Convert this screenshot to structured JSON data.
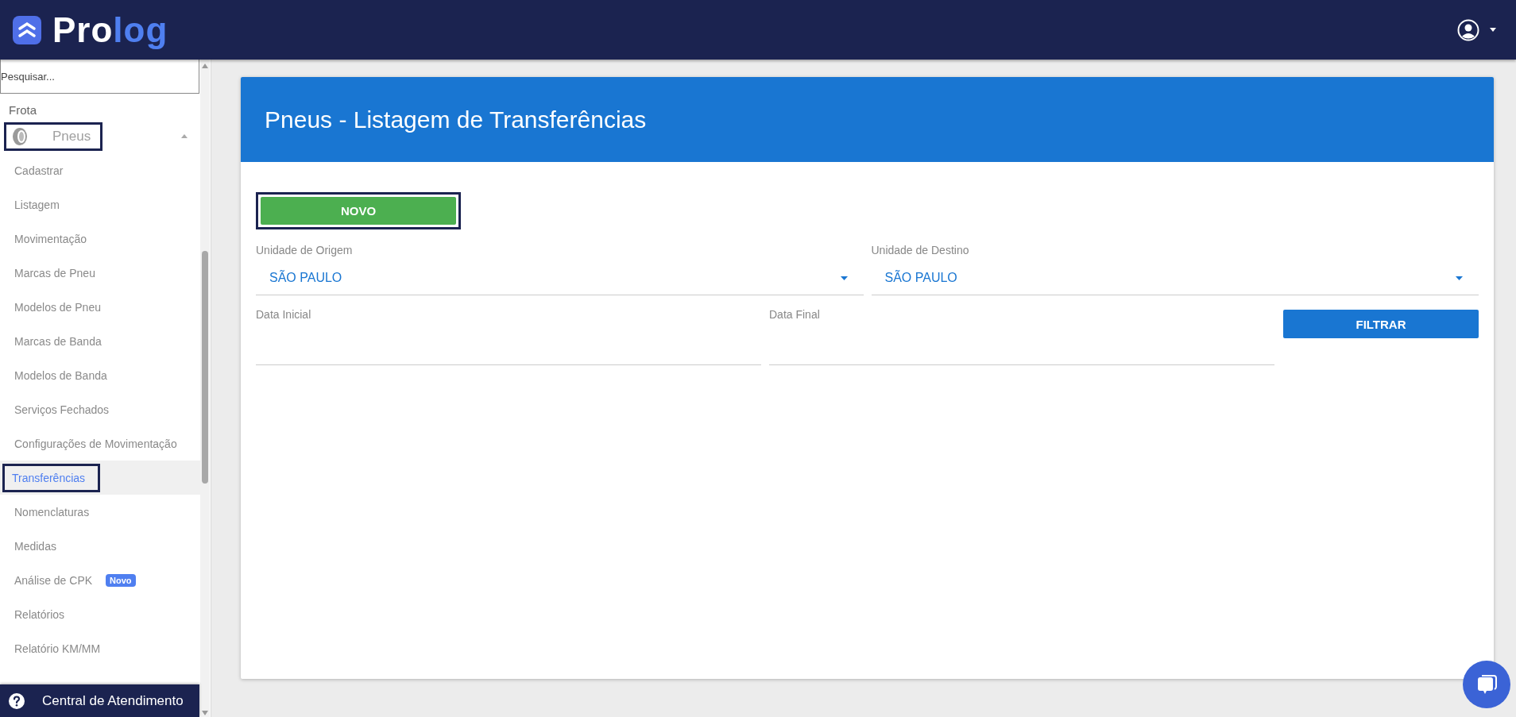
{
  "header": {
    "logo": [
      {
        "text": "Pro",
        "color": "#ffffff"
      },
      {
        "text": "log",
        "color": "#4f7ff0"
      }
    ]
  },
  "sidebar": {
    "search": {
      "placeholder": "Pesquisar..."
    },
    "section": "Frota",
    "groups": [
      {
        "label": "Pneus",
        "expanded": true,
        "outlined": true,
        "children": [
          {
            "label": "Cadastrar",
            "selected": false,
            "outlined": false
          },
          {
            "label": "Listagem",
            "selected": false,
            "outlined": false
          },
          {
            "label": "Movimentação",
            "selected": false,
            "outlined": false
          },
          {
            "label": "Marcas de Pneu",
            "selected": false,
            "outlined": false
          },
          {
            "label": "Modelos de Pneu",
            "selected": false,
            "outlined": false
          },
          {
            "label": "Marcas de Banda",
            "selected": false,
            "outlined": false
          },
          {
            "label": "Modelos de Banda",
            "selected": false,
            "outlined": false
          },
          {
            "label": "Serviços Fechados",
            "selected": false,
            "outlined": false
          },
          {
            "label": "Configurações de Movimentação",
            "selected": false,
            "outlined": false
          },
          {
            "label": "Transferências",
            "selected": true,
            "outlined": true
          },
          {
            "label": "Nomenclaturas",
            "selected": false,
            "outlined": false
          },
          {
            "label": "Medidas",
            "selected": false,
            "outlined": false
          },
          {
            "label": "Análise de CPK",
            "selected": false,
            "outlined": false,
            "badge": "Novo"
          },
          {
            "label": "Relatórios",
            "selected": false,
            "outlined": false
          },
          {
            "label": "Relatório KM/MM",
            "selected": false,
            "outlined": false
          }
        ]
      }
    ],
    "help": "Central de Atendimento"
  },
  "card": {
    "title": "Pneus - Listagem de Transferências",
    "new_button": {
      "label": "NOVO",
      "outlined": true
    },
    "selects": [
      {
        "label": "Unidade de Origem",
        "value": "SÃO PAULO"
      },
      {
        "label": "Unidade de Destino",
        "value": "SÃO PAULO"
      }
    ],
    "dates": [
      {
        "label": "Data Inicial"
      },
      {
        "label": "Data Final"
      }
    ],
    "filter_button": "FILTRAR"
  }
}
